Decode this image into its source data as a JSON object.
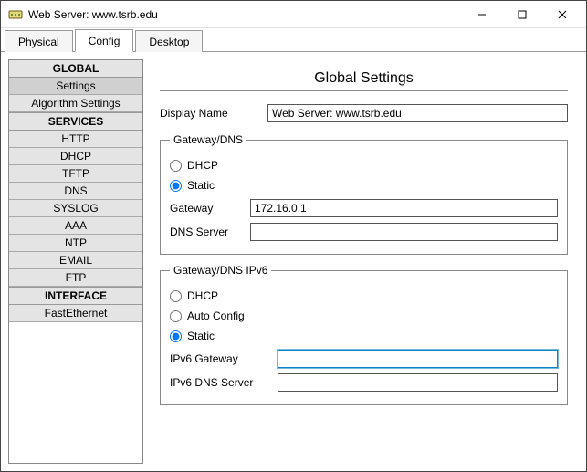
{
  "window": {
    "title": "Web Server: www.tsrb.edu"
  },
  "tabs": {
    "physical": "Physical",
    "config": "Config",
    "desktop": "Desktop"
  },
  "sidebar": {
    "global_header": "GLOBAL",
    "settings": "Settings",
    "algorithm_settings": "Algorithm Settings",
    "services_header": "SERVICES",
    "http": "HTTP",
    "dhcp": "DHCP",
    "tftp": "TFTP",
    "dns": "DNS",
    "syslog": "SYSLOG",
    "aaa": "AAA",
    "ntp": "NTP",
    "email": "EMAIL",
    "ftp": "FTP",
    "interface_header": "INTERFACE",
    "fastethernet": "FastEthernet"
  },
  "main": {
    "title": "Global Settings",
    "display_name_label": "Display Name",
    "display_name_value": "Web Server: www.tsrb.edu",
    "gwdns": {
      "legend": "Gateway/DNS",
      "dhcp_label": "DHCP",
      "static_label": "Static",
      "gateway_label": "Gateway",
      "gateway_value": "172.16.0.1",
      "dns_label": "DNS Server",
      "dns_value": ""
    },
    "gwdns6": {
      "legend": "Gateway/DNS IPv6",
      "dhcp_label": "DHCP",
      "autoconfig_label": "Auto Config",
      "static_label": "Static",
      "gateway_label": "IPv6 Gateway",
      "gateway_value": "",
      "dns_label": "IPv6 DNS Server",
      "dns_value": ""
    }
  }
}
